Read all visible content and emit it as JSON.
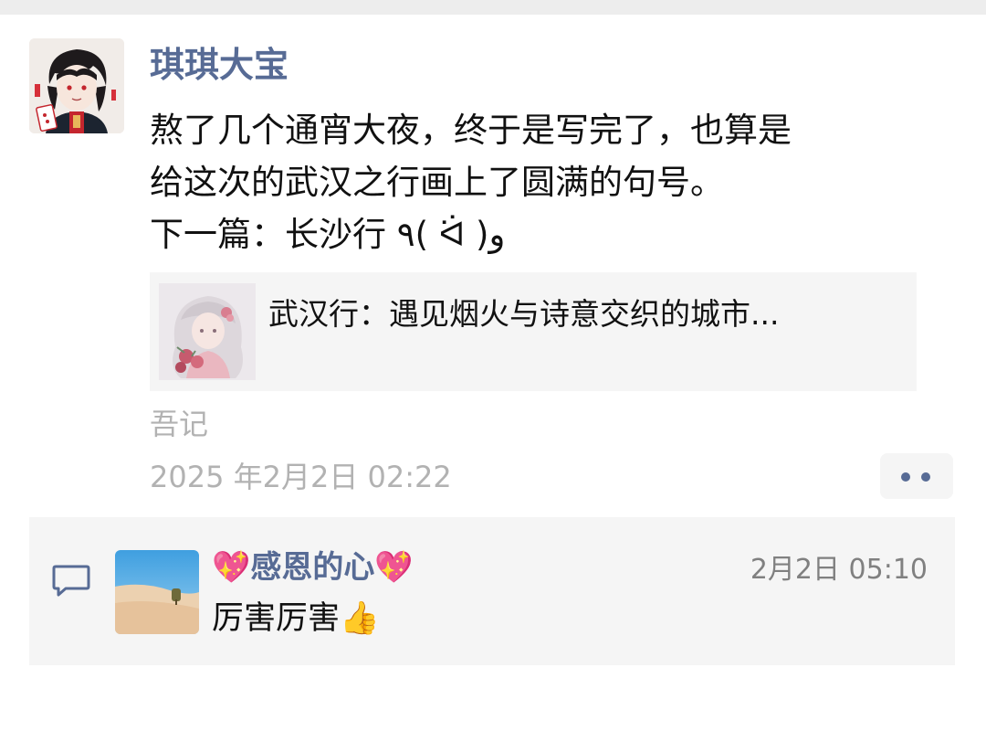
{
  "post": {
    "author": "琪琪大宝",
    "text_lines": [
      "熬了几个通宵大夜，终于是写完了，也算是",
      "给这次的武汉之行画上了圆满的句号。",
      "下一篇：长沙行 ٩( ᐛ )و"
    ],
    "link_card": {
      "title": "武汉行：遇见烟火与诗意交织的城市..."
    },
    "source": "吾记",
    "timestamp": "2025 年2月2日 02:22"
  },
  "comment": {
    "author": "💖感恩的心💖",
    "time": "2月2日 05:10",
    "text": "厉害厉害👍"
  },
  "colors": {
    "link_blue": "#576b95",
    "muted_gray": "#b2b2b2",
    "card_bg": "#f5f5f5"
  },
  "icons": [
    "comment-bubble-icon",
    "more-dots-icon"
  ]
}
